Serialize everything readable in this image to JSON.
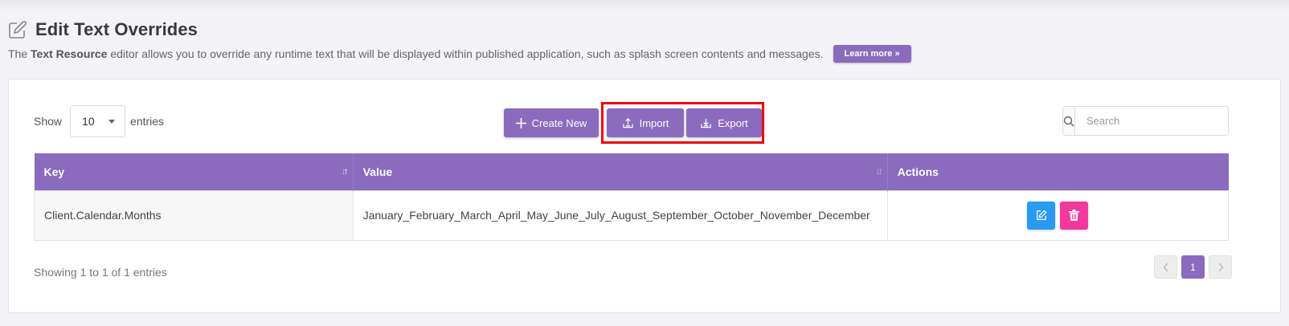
{
  "header": {
    "title": "Edit Text Overrides",
    "desc_prefix": "The ",
    "desc_bold": "Text Resource",
    "desc_suffix": " editor allows you to override any runtime text that will be displayed within published application, such as splash screen contents and messages.",
    "learn_more": "Learn more »"
  },
  "length": {
    "show_label": "Show",
    "value": "10",
    "entries_label": "entries"
  },
  "toolbar": {
    "create_label": "Create New",
    "import_label": "Import",
    "export_label": "Export"
  },
  "search": {
    "placeholder": "Search"
  },
  "table": {
    "headers": [
      "Key",
      "Value",
      "Actions"
    ],
    "rows": [
      {
        "key": "Client.Calendar.Months",
        "value": "January_February_March_April_May_June_July_August_September_October_November_December"
      }
    ]
  },
  "footer": {
    "info": "Showing 1 to 1 of 1 entries",
    "current_page": "1"
  },
  "colors": {
    "accent": "#8a6bbd",
    "edit": "#2b9af3",
    "delete": "#f0399b",
    "highlight": "#ee0000"
  }
}
